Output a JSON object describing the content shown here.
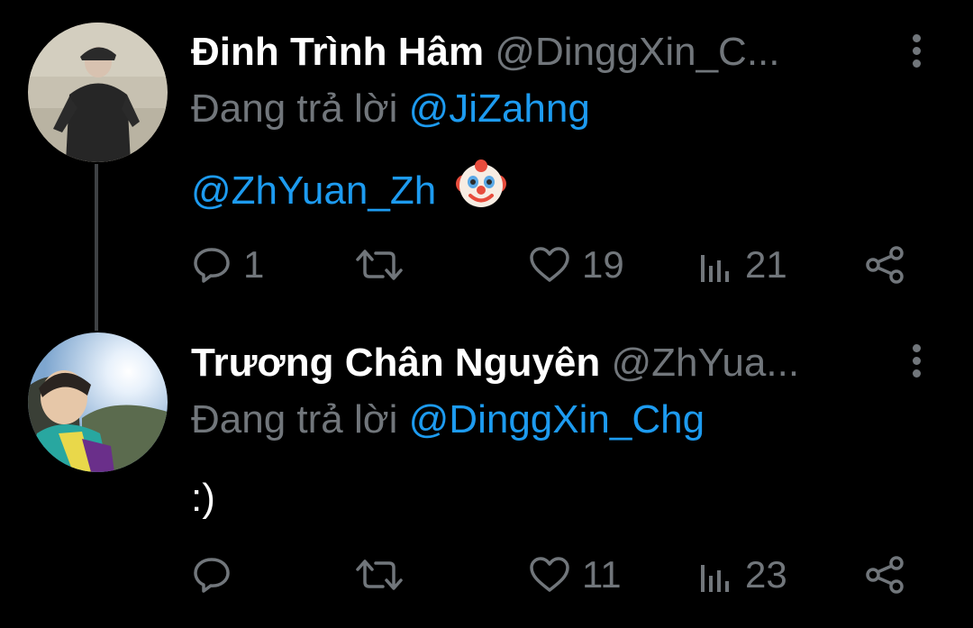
{
  "colors": {
    "background": "#000000",
    "primary_text": "#ffffff",
    "secondary_text": "#71767b",
    "link": "#1d9bf0",
    "thread_line": "#3e4144"
  },
  "tweets": [
    {
      "author_name": "Đinh Trình Hâm",
      "handle": "@DinggXin_C...",
      "reply_prefix": "Đang trả lời",
      "reply_to": "@JiZahng",
      "body_mention": "@ZhYuan_Zh",
      "body_emoji": "clown-face",
      "reply_count": "1",
      "retweet_count": "",
      "like_count": "19",
      "view_count": "21",
      "icons": [
        "reply-icon",
        "retweet-icon",
        "like-icon",
        "views-icon",
        "share-icon",
        "more-icon"
      ]
    },
    {
      "author_name": "Trương Chân Nguyên",
      "handle": "@ZhYua...",
      "reply_prefix": "Đang trả lời",
      "reply_to": "@DinggXin_Chg",
      "body_text": ":)",
      "reply_count": "",
      "retweet_count": "",
      "like_count": "11",
      "view_count": "23",
      "icons": [
        "reply-icon",
        "retweet-icon",
        "like-icon",
        "views-icon",
        "share-icon",
        "more-icon"
      ]
    }
  ]
}
